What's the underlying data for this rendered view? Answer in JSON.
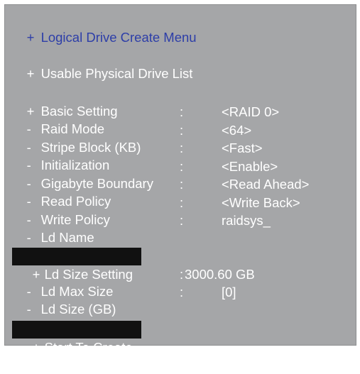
{
  "menu": {
    "title": "Logical Drive Create Menu",
    "physical_list": "Usable Physical Drive List",
    "basic_setting": "Basic Setting",
    "settings": [
      {
        "label": "Raid Mode",
        "value": "<RAID 0>"
      },
      {
        "label": "Stripe Block (KB)",
        "value": "<64>"
      },
      {
        "label": "Initialization",
        "value": "<Fast>"
      },
      {
        "label": "Gigabyte Boundary",
        "value": "<Enable>"
      },
      {
        "label": "Read Policy",
        "value": "<Read Ahead>"
      },
      {
        "label": "Write Policy",
        "value": "<Write Back>"
      },
      {
        "label": "Ld Name",
        "value": "raidsys_"
      }
    ],
    "size_setting": "Ld Size Setting",
    "ld_max_size_label": "Ld Max Size",
    "ld_max_size_value": "3000.60 GB",
    "ld_size_label": "Ld Size (GB)",
    "ld_size_value": "[0]",
    "start_create": "Start To Create"
  },
  "symbols": {
    "plus": "+",
    "dash": "-",
    "colon": ":"
  }
}
